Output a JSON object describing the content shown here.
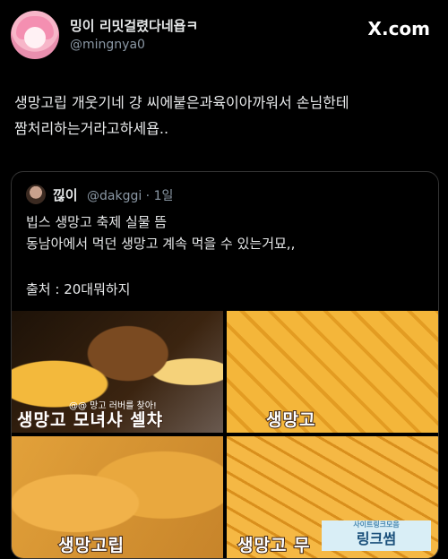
{
  "header": {
    "display_name": "밍이 리밋걸렸다네욥ㅋ",
    "handle": "@mingnya0",
    "brand": "X.com"
  },
  "tweet": {
    "text": "생망고립 개웃기네 걍 씨에붙은과육이아까워서 손님한테\n짬처리하는거라고하세욥.."
  },
  "quote": {
    "display_name": "낂이",
    "handle": "@dakggi · 1일",
    "body": "빕스 생망고 축제 실물 뜸\n동남아에서 먹던 생망고 계속 먹을 수 있는거묘,,",
    "source": "출처 : 20대뭐하지"
  },
  "photos": [
    {
      "caption": "생망고 모녀샤 셀챠",
      "overlay": "@@ 망고 러버를 찾아!"
    },
    {
      "caption": "생망고"
    },
    {
      "caption": "생망고립"
    },
    {
      "caption": "생망고 무"
    }
  ],
  "watermark": {
    "top": "사이트링크모음",
    "main": "링크썸"
  },
  "colors": {
    "background": "#000000",
    "text": "#e7e9ea",
    "muted": "#8b98a5",
    "border": "#333333"
  }
}
